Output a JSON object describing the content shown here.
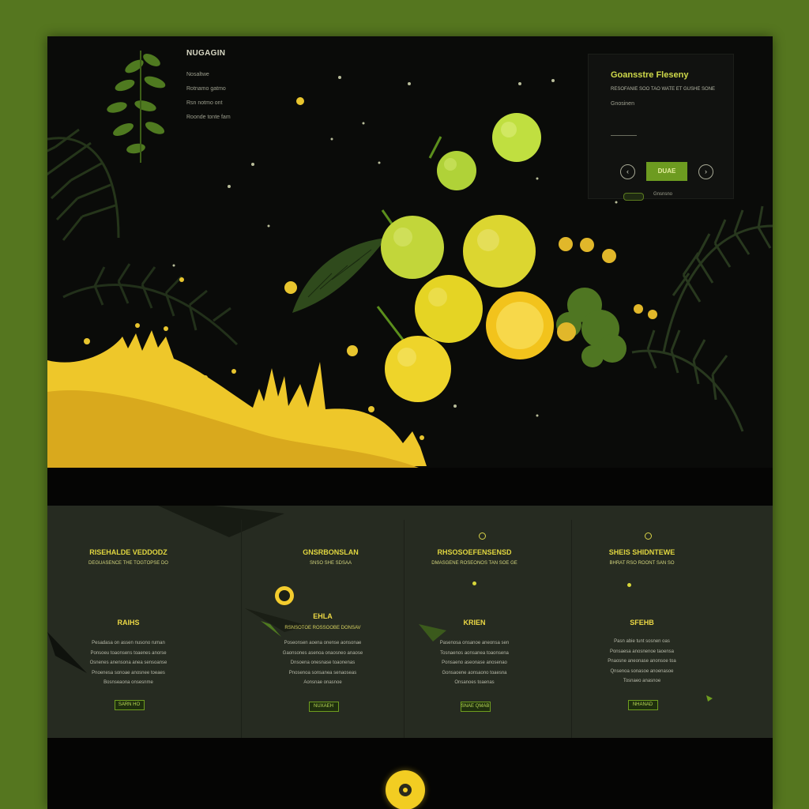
{
  "side_nav": {
    "brand": "NUGAGIN",
    "items": [
      "Nosaltwe",
      "Rotnamo gatmo",
      "Rsn notmo ont",
      "Roonde tonte fam"
    ]
  },
  "promo": {
    "title": "Goansstre Fleseny",
    "text": "RESOFANIE SOO TAO WATE ET GUSHE SONE",
    "subtitle": "Gnosinen",
    "cta": "DUAE",
    "footer_text": "Gnsnsno"
  },
  "features": [
    {
      "title": "RISEHALDE VEDDODZ",
      "subtitle": "DEGUASENCE THE TOGTOPSE DO",
      "heading": "RAIHS",
      "body": [
        "Pesadasa on assen nusono ruman",
        "Ponsoeu toaonsens toaenes anorse",
        "Osnenes anensona anea sensoanse",
        "Pnoenesa sonoae anosnee toeaes",
        "Bosnseaona onsesnme"
      ],
      "button": "SARN HO"
    },
    {
      "title": "GNSRBONSLAN",
      "subtitle": "SNSO SHE SDSAA",
      "heading": "EHLA",
      "subheading": "RSNSOTOE ROSSOOBE DONSAV",
      "body": [
        "Poseonsen aoena onense aonsonae",
        "Gaonsones asenoa onaosneo anaose",
        "Dnsoena onesnase toaonenas",
        "Pnosenoa sonsanea senaoseas",
        "Aonsnae onasnoe"
      ],
      "button": "NUXAEH"
    },
    {
      "title": "RHSOSOEFENSENSD",
      "subtitle": "DMASGENE ROSEONOS TAN SOE GE",
      "heading": "KRIEN",
      "body": [
        "Pasenosa onsanoe aneonsa sen",
        "Tosnaenos aonsanea toaonsena",
        "Ponsaeno aseonase anosenao",
        "Gonsaoene aonsaono toaesna",
        "Onsanoes toaenas"
      ],
      "button": "SNAE QMAB"
    },
    {
      "title": "SHEIS SHIDNTEWE",
      "subtitle": "BHRAT RSO ROONT SAN SO",
      "heading": "SFEHB",
      "body": [
        "Pasn abie tunt sosnen oas",
        "Ponsaesa anosnenoe taoensa",
        "Pnaosne aneonase anonsoe toa",
        "Qnsenoa sonasoe anoenasoe",
        "Tosnaeo anasnoe"
      ],
      "button": "NHANAD"
    }
  ]
}
